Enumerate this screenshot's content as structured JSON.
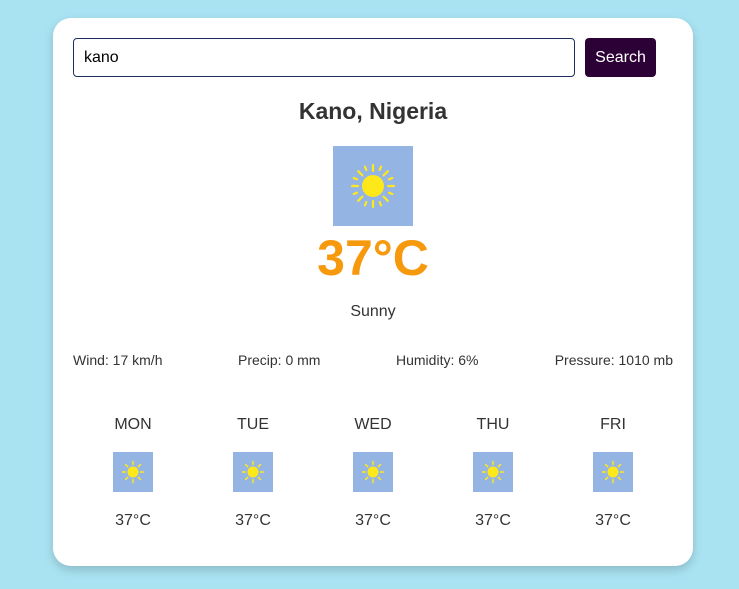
{
  "search": {
    "value": "kano",
    "button_label": "Search"
  },
  "current": {
    "location": "Kano, Nigeria",
    "icon": "sun-icon",
    "temperature": "37°C",
    "condition": "Sunny"
  },
  "details": {
    "wind": "Wind: 17 km/h",
    "precip": "Precip: 0 mm",
    "humidity": "Humidity: 6%",
    "pressure": "Pressure: 1010 mb"
  },
  "forecast": [
    {
      "day": "MON",
      "icon": "sun-icon",
      "temp": "37°C"
    },
    {
      "day": "TUE",
      "icon": "sun-icon",
      "temp": "37°C"
    },
    {
      "day": "WED",
      "icon": "sun-icon",
      "temp": "37°C"
    },
    {
      "day": "THU",
      "icon": "sun-icon",
      "temp": "37°C"
    },
    {
      "day": "FRI",
      "icon": "sun-icon",
      "temp": "37°C"
    }
  ],
  "colors": {
    "background": "#a9e3f2",
    "card": "#ffffff",
    "button": "#2c0135",
    "temperature": "#f7990d",
    "icon_background": "#94b4e3",
    "sun": "#ffe81a"
  }
}
